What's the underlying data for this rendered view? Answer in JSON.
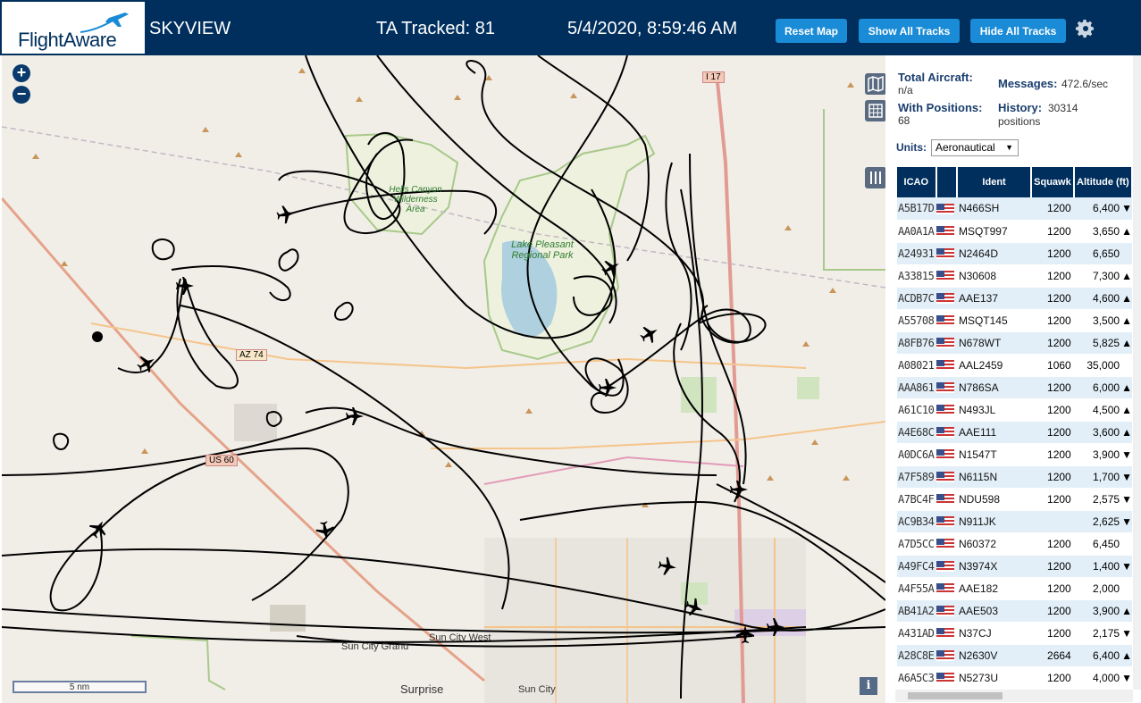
{
  "header": {
    "logo_text": "FlightAware",
    "title": "SKYVIEW",
    "tracked": "TA Tracked: 81",
    "datetime": "5/4/2020, 8:59:46 AM",
    "buttons": {
      "reset": "Reset Map",
      "show": "Show All Tracks",
      "hide": "Hide All Tracks"
    }
  },
  "stats": {
    "total_label": "Total Aircraft:",
    "total_value": "n/a",
    "positions_label": "With Positions:",
    "positions_value": "68",
    "messages_label": "Messages:",
    "messages_value": "472.6/sec",
    "history_label": "History:",
    "history_value": "30314",
    "history_unit": "positions"
  },
  "units": {
    "label": "Units:",
    "selected": "Aeronautical"
  },
  "table": {
    "headers": [
      "ICAO",
      "",
      "Ident",
      "Squawk",
      "Altitude (ft)"
    ],
    "rows": [
      {
        "icao": "A5B17D",
        "ident": "N466SH",
        "squawk": "1200",
        "alt": "6,400",
        "trend": "▼"
      },
      {
        "icao": "AA0A1A",
        "ident": "MSQT997",
        "squawk": "1200",
        "alt": "3,650",
        "trend": "▲"
      },
      {
        "icao": "A24931",
        "ident": "N2464D",
        "squawk": "1200",
        "alt": "6,650",
        "trend": ""
      },
      {
        "icao": "A33815",
        "ident": "N30608",
        "squawk": "1200",
        "alt": "7,300",
        "trend": "▲"
      },
      {
        "icao": "ACDB7C",
        "ident": "AAE137",
        "squawk": "1200",
        "alt": "4,600",
        "trend": "▲"
      },
      {
        "icao": "A55708",
        "ident": "MSQT145",
        "squawk": "1200",
        "alt": "3,500",
        "trend": "▲"
      },
      {
        "icao": "A8FB76",
        "ident": "N678WT",
        "squawk": "1200",
        "alt": "5,825",
        "trend": "▲"
      },
      {
        "icao": "A08021",
        "ident": "AAL2459",
        "squawk": "1060",
        "alt": "35,000",
        "trend": ""
      },
      {
        "icao": "AAA861",
        "ident": "N786SA",
        "squawk": "1200",
        "alt": "6,000",
        "trend": "▲"
      },
      {
        "icao": "A61C10",
        "ident": "N493JL",
        "squawk": "1200",
        "alt": "4,500",
        "trend": "▲"
      },
      {
        "icao": "A4E68C",
        "ident": "AAE111",
        "squawk": "1200",
        "alt": "3,600",
        "trend": "▲"
      },
      {
        "icao": "A0DC6A",
        "ident": "N1547T",
        "squawk": "1200",
        "alt": "3,900",
        "trend": "▼"
      },
      {
        "icao": "A7F589",
        "ident": "N6115N",
        "squawk": "1200",
        "alt": "1,700",
        "trend": "▼"
      },
      {
        "icao": "A7BC4F",
        "ident": "NDU598",
        "squawk": "1200",
        "alt": "2,575",
        "trend": "▼"
      },
      {
        "icao": "AC9B34",
        "ident": "N911JK",
        "squawk": "",
        "alt": "2,625",
        "trend": "▼"
      },
      {
        "icao": "A7D5CC",
        "ident": "N60372",
        "squawk": "1200",
        "alt": "6,450",
        "trend": ""
      },
      {
        "icao": "A49FC4",
        "ident": "N3974X",
        "squawk": "1200",
        "alt": "1,400",
        "trend": "▼"
      },
      {
        "icao": "A4F55A",
        "ident": "AAE182",
        "squawk": "1200",
        "alt": "2,000",
        "trend": ""
      },
      {
        "icao": "AB41A2",
        "ident": "AAE503",
        "squawk": "1200",
        "alt": "3,900",
        "trend": "▲"
      },
      {
        "icao": "A431AD",
        "ident": "N37CJ",
        "squawk": "1200",
        "alt": "2,175",
        "trend": "▼"
      },
      {
        "icao": "A28C8E",
        "ident": "N2630V",
        "squawk": "2664",
        "alt": "6,400",
        "trend": "▲"
      },
      {
        "icao": "A6A5C3",
        "ident": "N5273U",
        "squawk": "1200",
        "alt": "4,000",
        "trend": "▼"
      }
    ]
  },
  "map": {
    "scale": "5 nm",
    "info": "i",
    "labels": {
      "hells_canyon": "Hells Canyon Wilderness Area",
      "lake": "Lake Pleasant Regional Park",
      "sun_city_grand": "Sun City Grand",
      "sun_city_west": "Sun City West",
      "sun_city": "Sun City",
      "surprise": "Surprise",
      "us60": "US 60",
      "i17": "I 17",
      "az74": "AZ 74"
    }
  }
}
